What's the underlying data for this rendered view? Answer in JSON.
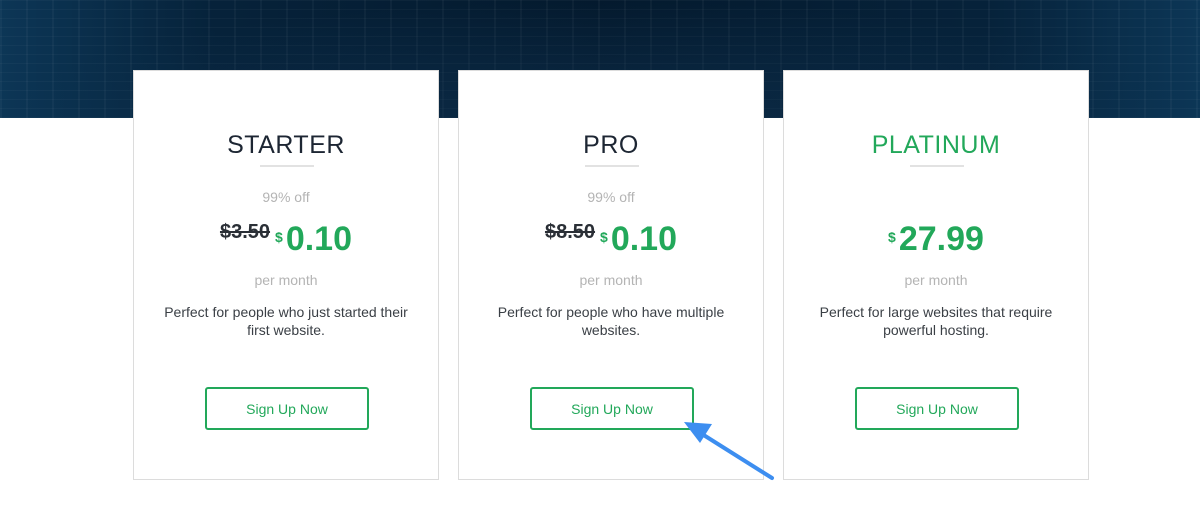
{
  "plans": [
    {
      "name": "STARTER",
      "discount": "99% off",
      "old_price": "$3.50",
      "currency": "$",
      "price": "0.10",
      "period": "per month",
      "description": "Perfect for people who just started their first website.",
      "button_label": "Sign Up Now"
    },
    {
      "name": "PRO",
      "discount": "99% off",
      "old_price": "$8.50",
      "currency": "$",
      "price": "0.10",
      "period": "per month",
      "description": "Perfect for people who have multiple websites.",
      "button_label": "Sign Up Now"
    },
    {
      "name": "PLATINUM",
      "currency": "$",
      "price": "27.99",
      "period": "per month",
      "description": "Perfect for large websites that require powerful hosting.",
      "button_label": "Sign Up Now"
    }
  ],
  "colors": {
    "accent": "#22a85a",
    "pointer": "#3d8ef0",
    "hero_dark": "#041a2e"
  },
  "annotation": {
    "icon": "arrow-pointer-icon"
  }
}
